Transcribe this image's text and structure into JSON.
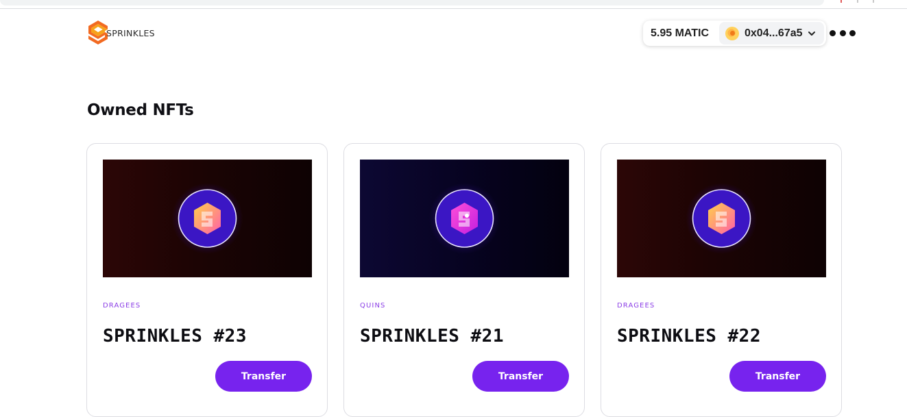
{
  "brand": {
    "name": "SPRINKLES"
  },
  "wallet": {
    "balance": "5.95 MATIC",
    "address": "0x04...67a5"
  },
  "page": {
    "title": "Owned NFTs"
  },
  "nfts": [
    {
      "category": "DRAGEES",
      "name": "SPRINKLES #23",
      "button": "Transfer",
      "theme": "red"
    },
    {
      "category": "QUINS",
      "name": "SPRINKLES #21",
      "button": "Transfer",
      "theme": "blue"
    },
    {
      "category": "DRAGEES",
      "name": "SPRINKLES #22",
      "button": "Transfer",
      "theme": "red"
    }
  ],
  "colors": {
    "accent": "#7723ee",
    "category_text": "#8a3ce6",
    "brand_orange": "#f26a21",
    "brand_yellow": "#f7a21b"
  }
}
